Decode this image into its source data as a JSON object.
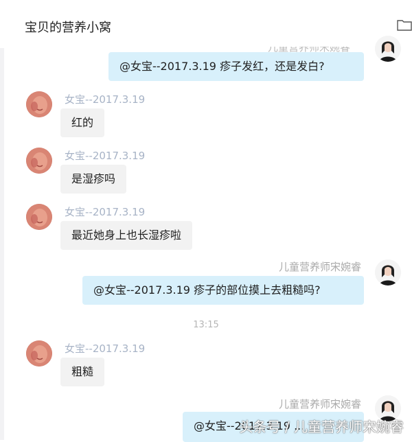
{
  "header": {
    "title": "宝贝的营养小窝"
  },
  "messages": [
    {
      "side": "right",
      "sender": "儿童营养师宋婉睿",
      "text": "@女宝--2017.3.19 疹子发红，还是发白?"
    },
    {
      "side": "left",
      "sender": "女宝--2017.3.19",
      "text": "红的"
    },
    {
      "side": "left",
      "sender": "女宝--2017.3.19",
      "text": "是湿疹吗"
    },
    {
      "side": "left",
      "sender": "女宝--2017.3.19",
      "text": "最近她身上也长湿疹啦"
    },
    {
      "side": "right",
      "sender": "儿童营养师宋婉睿",
      "text": "@女宝--2017.3.19 疹子的部位摸上去粗糙吗?"
    },
    {
      "type": "time",
      "text": "13:15"
    },
    {
      "side": "left",
      "sender": "女宝--2017.3.19",
      "text": "粗糙"
    },
    {
      "side": "right",
      "sender": "儿童营养师宋婉睿",
      "text": "@女宝--2017.3.19 ..."
    }
  ],
  "watermark": "头条号 / 儿童营养师宋婉睿",
  "icons": {
    "folder": "folder-icon",
    "avatar_left": "baby-avatar",
    "avatar_right": "nutritionist-avatar"
  }
}
